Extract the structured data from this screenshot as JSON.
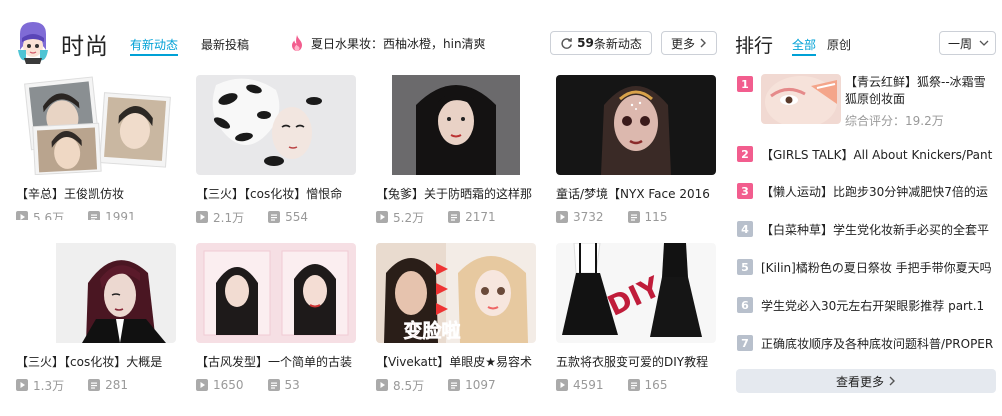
{
  "header": {
    "title": "时尚",
    "tabs": [
      "有新动态",
      "最新投稿"
    ],
    "promo_text": "夏日水果妆：西柚冰橙，hin清爽",
    "new_count": "59",
    "new_suffix": "条新动态",
    "more_label": "更多"
  },
  "ranking": {
    "title": "排行",
    "tabs": [
      "全部",
      "原创"
    ],
    "period": "一周",
    "first": {
      "title": "【青云红鲜】狐祭--冰霜雪狐原创妆面",
      "score": "综合评分：19.2万"
    },
    "items": [
      {
        "rank": "1"
      },
      {
        "rank": "2",
        "title": "【GIRLS TALK】All About Knickers/Panti"
      },
      {
        "rank": "3",
        "title": "【懒人运动】比跑步30分钟减肥快7倍的运"
      },
      {
        "rank": "4",
        "title": "【白菜种草】学生党化妆新手必买的全套平"
      },
      {
        "rank": "5",
        "title": "[Kilin]橘粉色の夏日祭妆 手把手带你夏天吗"
      },
      {
        "rank": "6",
        "title": "学生党必入30元左右开架眼影推荐 part.1"
      },
      {
        "rank": "7",
        "title": "正确底妆顺序及各种底妆问题科普/PROPER"
      }
    ],
    "see_more": "查看更多"
  },
  "videos": [
    {
      "title": "【辛总】王俊凯仿妆",
      "plays": "5.6万",
      "danmaku": "1991"
    },
    {
      "title": "【三火】【cos化妆】憎恨命",
      "plays": "2.1万",
      "danmaku": "554"
    },
    {
      "title": "【兔爹】关于防晒霜的这样那",
      "plays": "5.2万",
      "danmaku": "2171"
    },
    {
      "title": "童话/梦境【NYX Face 2016",
      "plays": "3732",
      "danmaku": "115"
    },
    {
      "title": "【三火】【cos化妆】大概是",
      "plays": "1.3万",
      "danmaku": "281"
    },
    {
      "title": "【古风发型】一个简单的古装",
      "plays": "1650",
      "danmaku": "53"
    },
    {
      "title": "【Vivekatt】单眼皮★易容术",
      "plays": "8.5万",
      "danmaku": "1097"
    },
    {
      "title": "五款将衣服变可爱的DIY教程",
      "plays": "4591",
      "danmaku": "165"
    }
  ],
  "thumb_texts": {
    "face_change": "变脸啦",
    "diy": "DIY"
  },
  "colors": {
    "accent": "#00a1d6",
    "rank_hot": "#f25d8e",
    "rank_normal": "#b8c0cc"
  }
}
